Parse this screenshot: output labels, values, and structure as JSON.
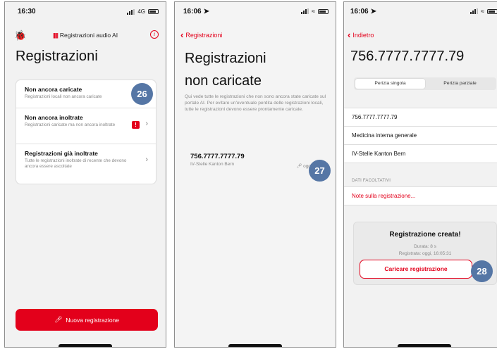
{
  "screen1": {
    "time": "16:30",
    "network": "4G",
    "app_title": "Registrazioni audio AI",
    "page_title": "Registrazioni",
    "items": [
      {
        "title": "Non ancora caricate",
        "subtitle": "Registrazioni locali non ancora caricate"
      },
      {
        "title": "Non ancora inoltrate",
        "subtitle": "Registrazioni caricate ma non ancora inoltrate",
        "badge": "!"
      },
      {
        "title": "Registrazioni già inoltrate",
        "subtitle": "Tutte le registrazioni inoltrate di recente che devono ancora essere ascoltate"
      }
    ],
    "step": "26",
    "new_button": "Nuova registrazione"
  },
  "screen2": {
    "time": "16:06",
    "back_label": "Registrazioni",
    "title_line1": "Registrazioni",
    "title_line2": "non caricate",
    "description": "Qui vede tutte le registrazioni che non sono ancora state caricate sul portale AI. Per evitare un'eventuale perdita delle registrazioni locali, tutte le registrazioni devono essere prontamente caricate.",
    "recording": {
      "number": "756.7777.7777.79",
      "location": "IV-Stelle Kanton Bern",
      "when": "oggi, 16:05"
    },
    "step": "27"
  },
  "screen3": {
    "time": "16:06",
    "back_label": "Indietro",
    "title": "756.7777.7777.79",
    "segments": [
      "Perizia singola",
      "Perizia parziale"
    ],
    "rows": [
      "756.7777.7777.79",
      "Medicina interna generale",
      "IV-Stelle Kanton Bern"
    ],
    "optional_label": "DATI FACOLTATIVI",
    "notes_row": "Note sulla registrazione...",
    "created": {
      "title": "Registrazione creata!",
      "duration": "Durata: 8 s",
      "recorded": "Registrata: oggi, 16:05:31",
      "button": "Caricare registrazione"
    },
    "step": "28"
  },
  "colors": {
    "accent": "#e3001b",
    "step_badge": "#5576a5"
  },
  "icons": [
    "bug-icon",
    "waveform-icon",
    "info-icon",
    "chevron-right-icon",
    "microphone-icon",
    "back-chevron-icon",
    "location-arrow-icon"
  ]
}
